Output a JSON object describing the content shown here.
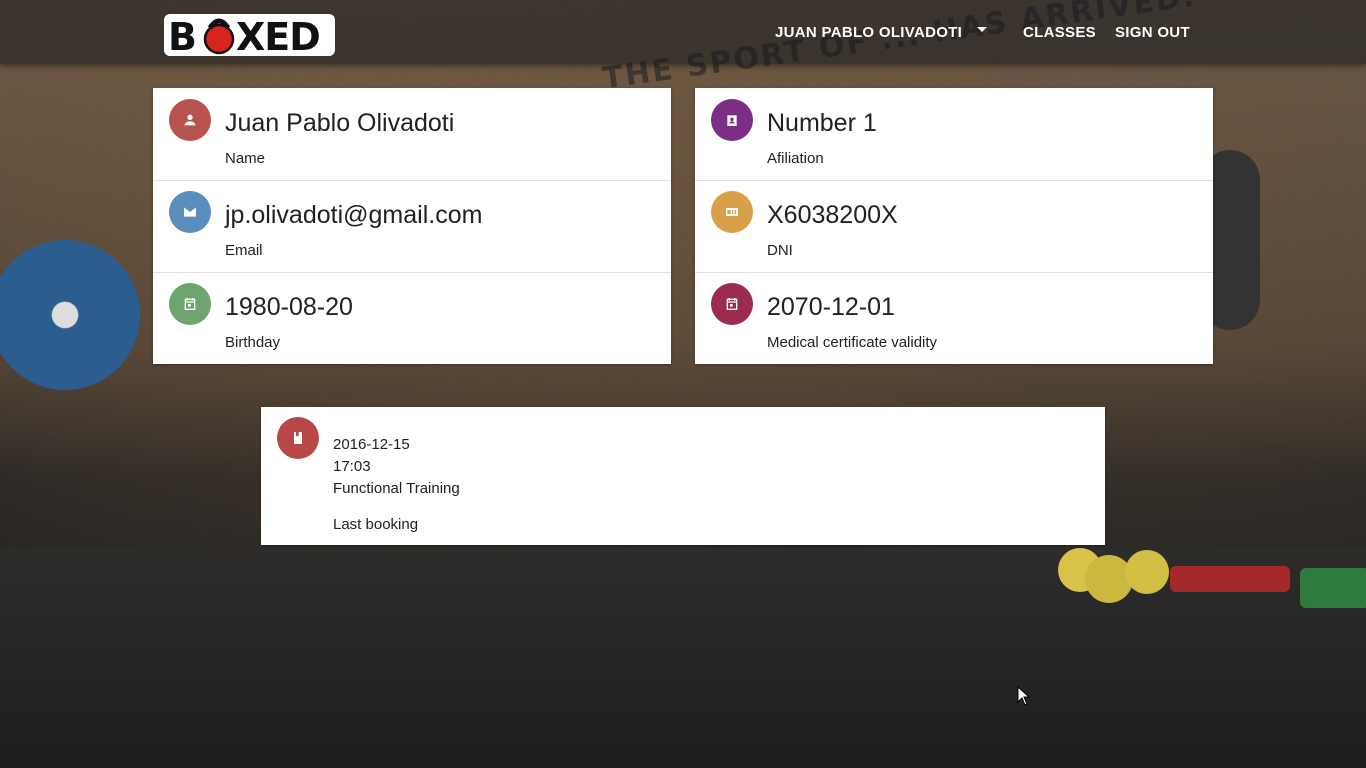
{
  "app": {
    "logo_text": "BOXED"
  },
  "nav": {
    "user_label": "JUAN PABLO OLIVADOTI",
    "classes_label": "CLASSES",
    "signout_label": "SIGN OUT"
  },
  "background": {
    "wall_text": "THE SPORT OF ... HAS ARRIVED."
  },
  "profile_left": [
    {
      "value": "Juan Pablo Olivadoti",
      "label": "Name",
      "icon": "person-icon",
      "color": "#b85450"
    },
    {
      "value": "jp.olivadoti@gmail.com",
      "label": "Email",
      "icon": "email-icon",
      "color": "#5b8dbd"
    },
    {
      "value": "1980-08-20",
      "label": "Birthday",
      "icon": "calendar-icon",
      "color": "#6ea56e"
    }
  ],
  "profile_right": [
    {
      "value": "Number 1",
      "label": "Afiliation",
      "icon": "badge-icon",
      "color": "#7b2f84"
    },
    {
      "value": "X6038200X",
      "label": "DNI",
      "icon": "id-card-icon",
      "color": "#d9a04a"
    },
    {
      "value": "2070-12-01",
      "label": "Medical certificate validity",
      "icon": "calendar-icon",
      "color": "#9c2c4e"
    }
  ],
  "last_booking": {
    "date": "2016-12-15",
    "time": "17:03",
    "class_name": "Functional Training",
    "label": "Last booking",
    "icon": "book-icon",
    "color": "#b84848"
  }
}
